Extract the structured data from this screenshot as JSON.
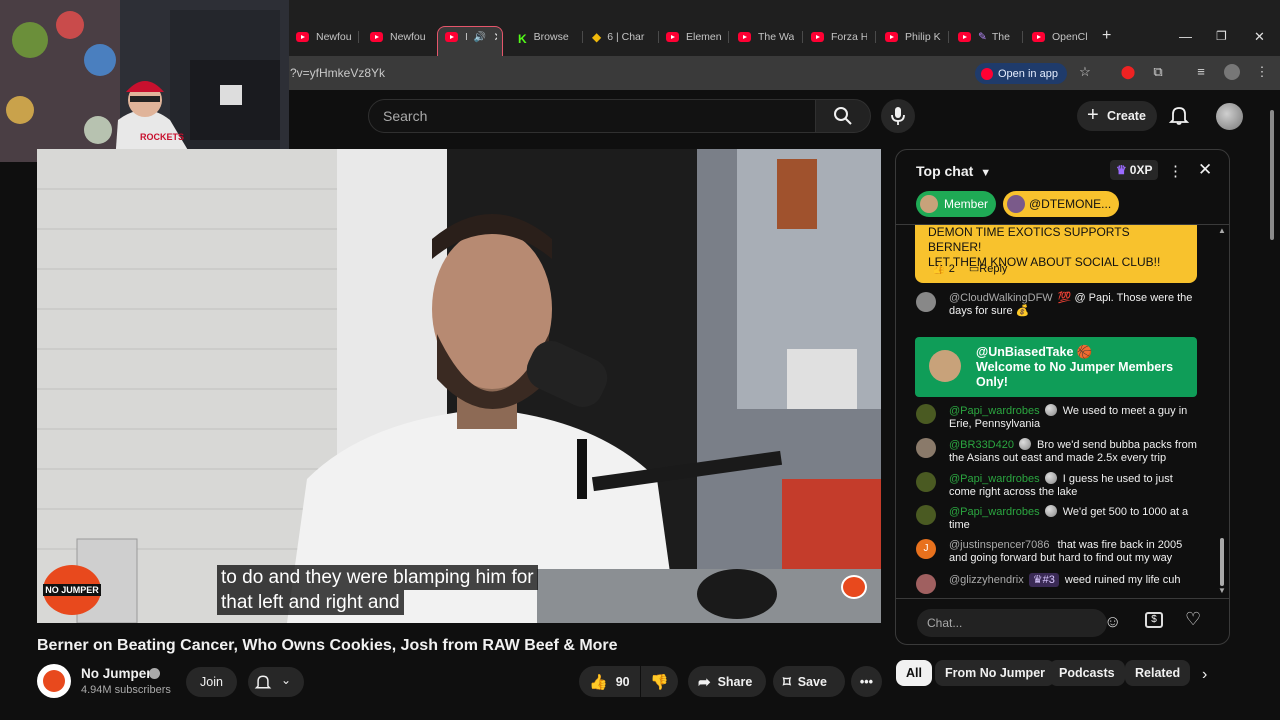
{
  "browser": {
    "tabs": [
      {
        "label": "Newfou",
        "icon": "youtube-icon"
      },
      {
        "label": "Newfou",
        "icon": "youtube-icon"
      },
      {
        "label": "I",
        "icon": "youtube-icon",
        "active": true,
        "audio": true
      },
      {
        "label": "Browse",
        "icon": "kick-icon"
      },
      {
        "label": "6 | Char",
        "icon": "binance-icon"
      },
      {
        "label": "Elemen",
        "icon": "youtube-icon"
      },
      {
        "label": "The Wa",
        "icon": "youtube-icon"
      },
      {
        "label": "Forza H",
        "icon": "youtube-icon"
      },
      {
        "label": "Philip K",
        "icon": "youtube-icon"
      },
      {
        "label": "The",
        "icon": "youtube-icon"
      },
      {
        "label": "OpenCl",
        "icon": "youtube-icon"
      }
    ],
    "url": "?v=yfHmkeVz8Yk",
    "open_in_app": "Open in app"
  },
  "header": {
    "search_placeholder": "Search",
    "create_label": "Create"
  },
  "video": {
    "caption_line1": "to do and they were blamping him for",
    "caption_line2": "that left and right and",
    "watermark": "NO JUMPER",
    "title": "Berner on Beating Cancer, Who Owns Cookies, Josh from RAW Beef & More",
    "channel": "No Jumper",
    "subscribers": "4.94M subscribers",
    "join_label": "Join",
    "likes": "90",
    "share_label": "Share",
    "save_label": "Save"
  },
  "chat": {
    "mode_label": "Top chat",
    "xp_label": "0XP",
    "chips": [
      "Member",
      "@DTEMONE..."
    ],
    "pinned": {
      "text_line1": "DEMON TIME EXOTICS SUPPORTS BERNER!",
      "text_line2": "LET THEM KNOW ABOUT SOCIAL CLUB!!",
      "likes": "2",
      "reply_label": "Reply"
    },
    "welcome": {
      "author": "@UnBiasedTake",
      "text_line1": "Welcome to No Jumper Members",
      "text_line2": "Only!"
    },
    "messages": [
      {
        "author": "@CloudWalkingDFW",
        "text": "@ Papi. Those were the days for sure",
        "member": false,
        "emoji_pre": "💯",
        "emoji_post": "💰"
      },
      {
        "author": "@Papi_wardrobes",
        "text": "We used to meet a guy in Erie, Pennsylvania",
        "member": true
      },
      {
        "author": "@BR33D420",
        "text": "Bro we'd send bubba packs from the Asians out east and made 2.5x every trip",
        "member": true
      },
      {
        "author": "@Papi_wardrobes",
        "text": "I guess he used to just come right across the lake",
        "member": true
      },
      {
        "author": "@Papi_wardrobes",
        "text": "We'd get 500 to 1000 at a time",
        "member": true
      },
      {
        "author": "@justinspencer7086",
        "text": "that was fire back in 2005 and going forward but hard to find out my way",
        "member": false,
        "initial": "J"
      },
      {
        "author": "@glizzyhendrix",
        "text": "weed ruined my life cuh",
        "member": false,
        "badge": "#3"
      }
    ],
    "input_placeholder": "Chat..."
  },
  "recommendation_chips": [
    "All",
    "From No Jumper",
    "Podcasts",
    "Related"
  ],
  "colors": {
    "accent_red": "#ff0033",
    "member_green": "#2ba640",
    "pinned_yellow": "#f8c22d",
    "welcome_green": "#0f9d58"
  }
}
